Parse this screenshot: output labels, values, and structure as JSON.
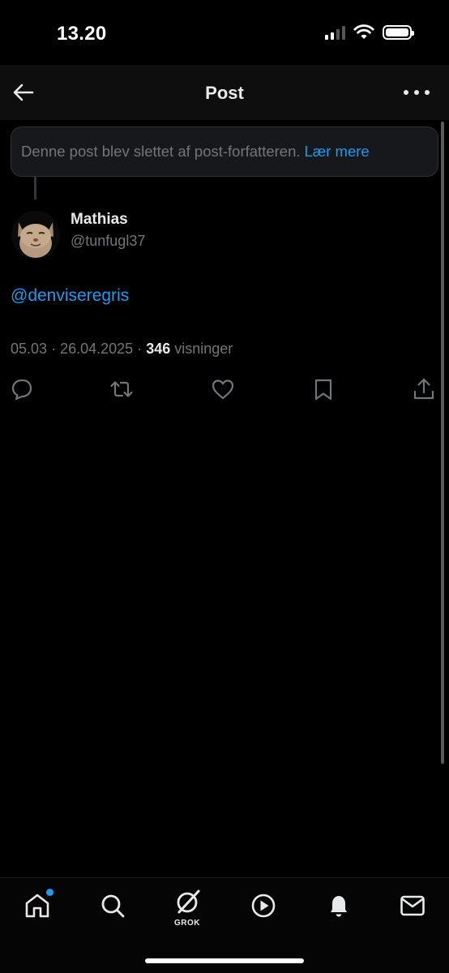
{
  "status_bar": {
    "time": "13.20",
    "icons": [
      "signal-icon",
      "wifi-icon",
      "battery-icon"
    ]
  },
  "header": {
    "title": "Post",
    "back_icon": "arrow-left-icon",
    "more_icon": "more-horizontal-icon"
  },
  "deleted_notice": {
    "text": "Denne post blev slettet af post-forfatteren.",
    "link": "Lær mere"
  },
  "post": {
    "author_name": "Mathias",
    "author_handle": "@tunfugl37",
    "body": "@denviseregris",
    "time": "05.03",
    "separator": "·",
    "date": "26.04.2025",
    "views_count": "346",
    "views_label": "visninger"
  },
  "actions": [
    "reply-icon",
    "repost-icon",
    "like-icon",
    "bookmark-icon",
    "share-icon"
  ],
  "bottom_nav": {
    "items": [
      "home-icon",
      "search-icon",
      "grok-icon",
      "video-icon",
      "notifications-icon",
      "messages-icon"
    ],
    "grok_label": "GROK"
  },
  "colors": {
    "accent": "#1d9bf0",
    "background": "#000000",
    "primary_text": "#e7e9ea",
    "secondary_text": "#71767b",
    "card_background": "#16181c"
  }
}
